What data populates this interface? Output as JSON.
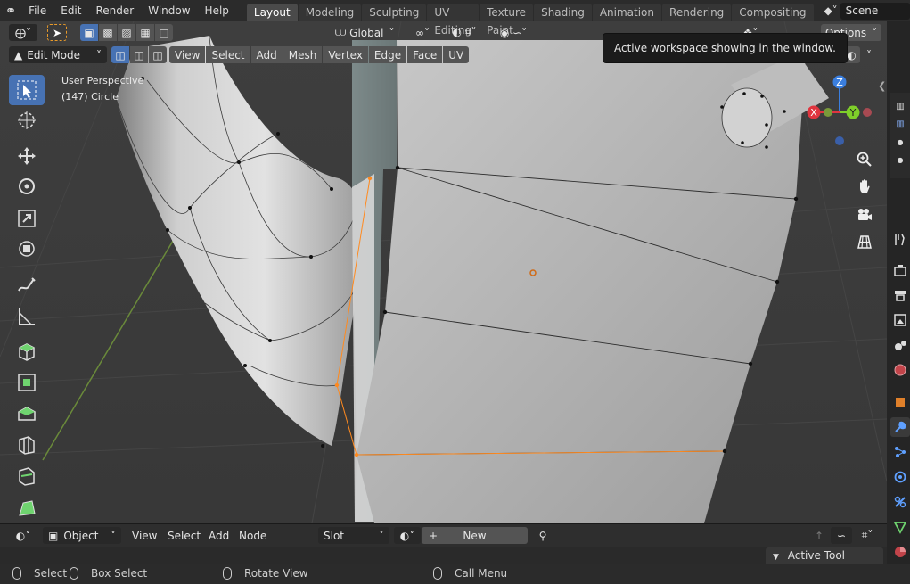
{
  "topbar": {
    "menus": [
      "File",
      "Edit",
      "Render",
      "Window",
      "Help"
    ],
    "workspaces": [
      "Layout",
      "Modeling",
      "Sculpting",
      "UV Editing",
      "Texture Paint",
      "Shading",
      "Animation",
      "Rendering",
      "Compositing"
    ],
    "active_workspace": "Layout",
    "scene": "Scene"
  },
  "header": {
    "orientation": "Global",
    "options_label": "Options",
    "mode": "Edit Mode",
    "menus": [
      "View",
      "Select",
      "Add",
      "Mesh",
      "Vertex",
      "Edge",
      "Face",
      "UV"
    ]
  },
  "tooltip": {
    "text": "Active workspace showing in the window."
  },
  "viewport": {
    "perspective": "User Perspective",
    "object": "(147) Circle",
    "gizmo": {
      "x": "X",
      "y": "Y",
      "z": "Z"
    }
  },
  "bottom_header": {
    "editor_mode": "Object",
    "menus": [
      "View",
      "Select",
      "Add",
      "Node"
    ],
    "slot": "Slot",
    "new_label": "New",
    "active_tool_label": "Active Tool"
  },
  "statusbar": {
    "select": "Select",
    "box_select": "Box Select",
    "rotate_view": "Rotate View",
    "call_menu": "Call Menu"
  },
  "colors": {
    "accent": "#4772b3",
    "x_axis": "#e0353f",
    "y_axis": "#7fcf2a",
    "z_axis": "#3a7ede",
    "selection": "#ff8a1f"
  }
}
